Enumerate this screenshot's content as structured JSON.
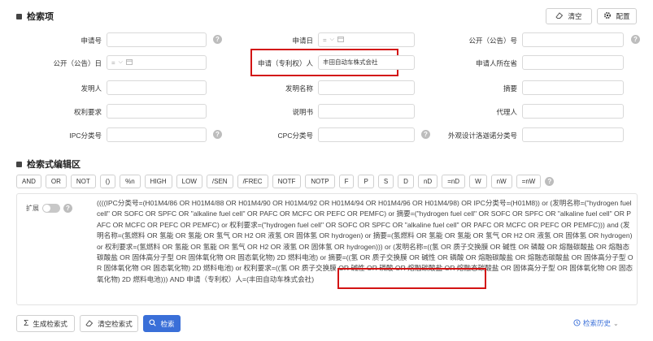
{
  "section1": {
    "title": "检索项",
    "clear_label": "清空",
    "config_label": "配置"
  },
  "fields": {
    "app_no": "申请号",
    "app_date": "申请日",
    "pub_no": "公开（公告）号",
    "pub_date": "公开（公告）日",
    "applicant": "申请（专利权）人",
    "applicant_value": "丰田自动车株式会社",
    "applicant_province": "申请人所在省",
    "inventor": "发明人",
    "invention_name": "发明名称",
    "abstract": "摘要",
    "claims": "权利要求",
    "description": "说明书",
    "agent": "代理人",
    "ipc": "IPC分类号",
    "cpc": "CPC分类号",
    "design_class": "外观设计洛迦诺分类号",
    "date_op": "=",
    "date_chevron": "⌵"
  },
  "section2": {
    "title": "检索式编辑区",
    "operators": [
      "AND",
      "OR",
      "NOT",
      "()",
      "%n",
      "HIGH",
      "LOW",
      "/SEN",
      "/FREC",
      "NOTF",
      "NOTP",
      "F",
      "P",
      "S",
      "D",
      "nD",
      "=nD",
      "W",
      "nW",
      "=nW"
    ],
    "expand_label": "扩展"
  },
  "query": {
    "main": "((((IPC分类号=(H01M4/86 OR H01M4/88 OR H01M4/90 OR H01M4/92 OR H01M4/94 OR H01M4/96 OR H01M4/98) OR IPC分类号=(H01M8)) or (发明名称=(\"hydrogen fuel cell\" OR SOFC OR SPFC OR \"alkaline fuel cell\" OR PAFC OR MCFC OR PEFC OR PEMFC) or 摘要=(\"hydrogen fuel cell\" OR SOFC OR SPFC OR \"alkaline fuel cell\" OR PAFC OR MCFC OR PEFC OR PEMFC) or 权利要求=(\"hydrogen fuel cell\" OR SOFC OR SPFC OR \"alkaline fuel cell\" OR PAFC OR MCFC OR PEFC OR PEMFC))) and (发明名称=(氢燃料 OR 氢能 OR 氢能 OR 氢气 OR H2 OR 液氢 OR 固体氢 OR hydrogen) or 摘要=(氢燃料 OR 氢能 OR 氢能 OR 氢气 OR H2 OR 液氢 OR 固体氢 OR hydrogen) or 权利要求=(氢燃料 OR 氢能 OR 氢能 OR 氢气 OR H2 OR 液氢 OR 固体氢 OR hydrogen))) or (发明名称=((氢 OR 质子交换膜 OR 碱性 OR 磷酸 OR 熔融碳酸盐 OR 熔融态碳酸盐 OR 固体高分子型 OR 固体氧化物 OR 固态氧化物) 2D 燃料电池) or 摘要=((氢 OR 质子交换膜 OR 碱性 OR 磷酸 OR 熔融碳酸盐 OR 熔融态碳酸盐 OR 固体高分子型 OR 固体氧化物 OR 固态氧化物) 2D 燃料电池) or 权利要求=((氢 OR 质子交换膜 OR 碱性 OR 磷酸 OR 熔融碳酸盐 OR 熔融态碳酸盐 OR 固体高分子型 OR 固体氧化物 OR 固态氧化物) 2D 燃料电池))) AND ",
    "tail": "申请（专利权）人=(丰田自动车株式会社)"
  },
  "footer": {
    "generate_label": "生成检索式",
    "clear_query_label": "清空检索式",
    "search_label": "检索",
    "history_label": "检索历史"
  },
  "colors": {
    "accent": "#3a6fd8",
    "highlight": "#d31414"
  }
}
